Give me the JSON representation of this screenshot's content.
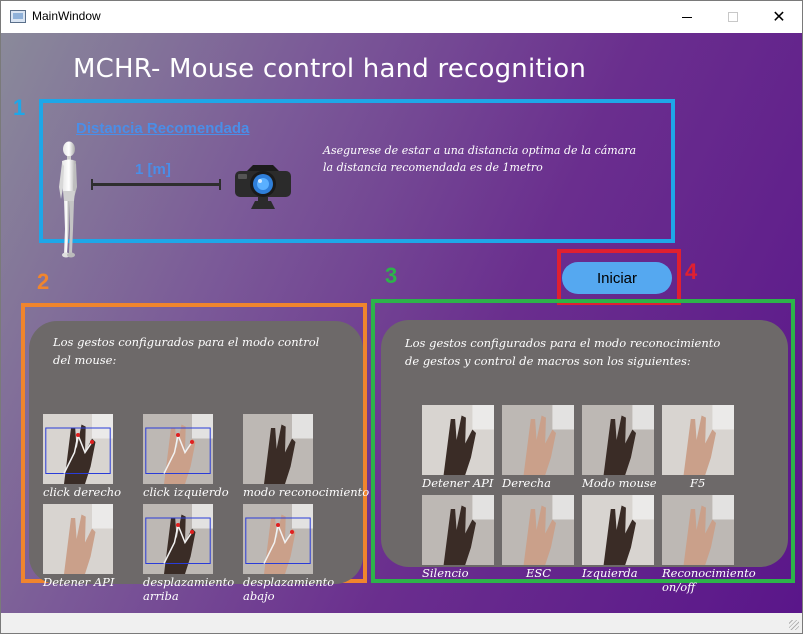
{
  "window": {
    "title": "MainWindow",
    "icon": "app-window-icon"
  },
  "window_controls": {
    "minimize_icon": "minimize-icon",
    "maximize_icon": "maximize-icon",
    "close_icon": "close-icon",
    "close_glyph": "✕"
  },
  "header": {
    "title": "MCHR- Mouse control hand recognition"
  },
  "section_numbers": {
    "n1": "1",
    "n2": "2",
    "n3": "3",
    "n4": "4"
  },
  "distance": {
    "title": "Distancia Recomendada",
    "label": "1 [m]",
    "instructions": [
      "Asegurese de estar a una distancia optima de la cámara",
      "la distancia recomendada es de 1metro"
    ]
  },
  "start_button": {
    "label": "Iniciar"
  },
  "mouse_gestures": {
    "description": [
      "Los gestos configurados para el modo control",
      "del mouse:"
    ],
    "items": [
      {
        "caption": [
          "click derecho"
        ]
      },
      {
        "caption": [
          "click izquierdo"
        ]
      },
      {
        "caption": [
          "modo reconocimiento"
        ]
      },
      {
        "caption": [
          "Detener API"
        ]
      },
      {
        "caption": [
          "desplazamiento",
          "arriba"
        ]
      },
      {
        "caption": [
          "desplazamiento",
          "abajo"
        ]
      }
    ]
  },
  "macro_gestures": {
    "description": [
      "Los gestos configurados para el modo reconocimiento",
      "de gestos y control de macros son los siguientes:"
    ],
    "items": [
      {
        "caption": [
          "Detener API"
        ]
      },
      {
        "caption": [
          "Derecha"
        ]
      },
      {
        "caption": [
          "Modo mouse"
        ]
      },
      {
        "caption": [
          "F5"
        ]
      },
      {
        "caption": [
          "Silencio"
        ]
      },
      {
        "caption": [
          "ESC"
        ]
      },
      {
        "caption": [
          "Izquierda"
        ]
      },
      {
        "caption": [
          "Reconocimiento",
          "on/off"
        ]
      }
    ]
  },
  "colors": {
    "box_1": "#1ea7e8",
    "box_2": "#f0852d",
    "box_3": "#2db34a",
    "box_4": "#e02030",
    "button": "#55a8f0",
    "panel": "#6d6969",
    "background_start": "#8a8a9a",
    "background_end": "#5a168a"
  }
}
